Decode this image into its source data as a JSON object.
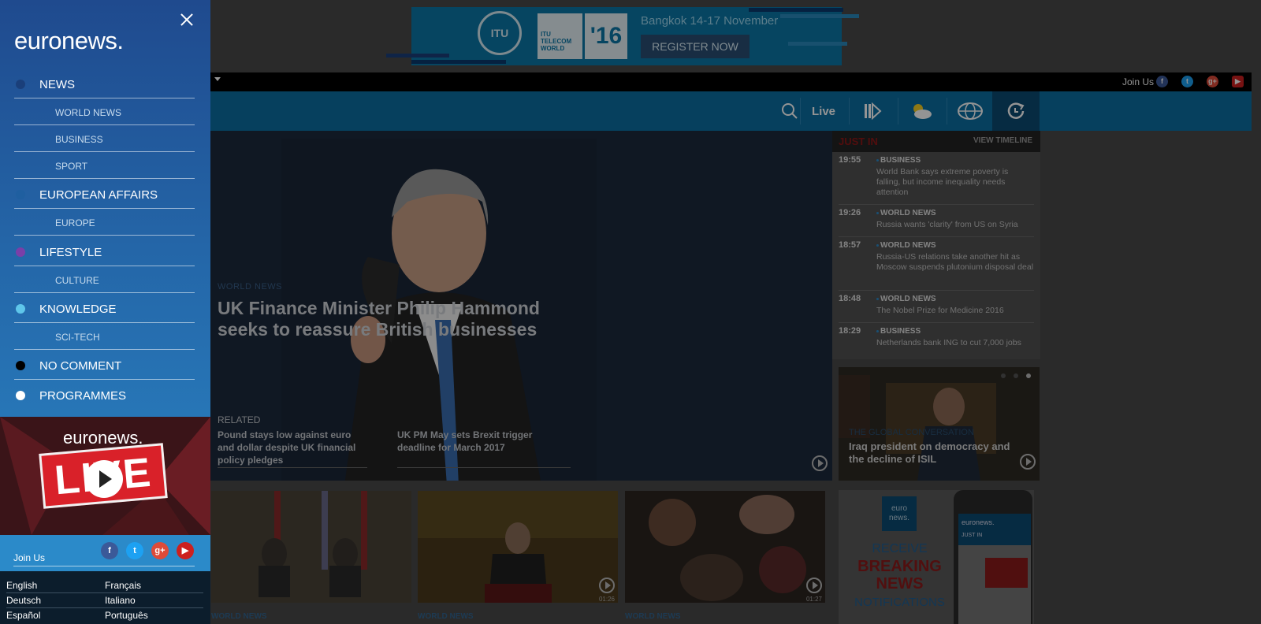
{
  "menu": {
    "brand": "euronews.",
    "items": [
      {
        "label": "NEWS",
        "dot_color": "#1a3f7a",
        "type": "main"
      },
      {
        "label": "WORLD NEWS",
        "type": "sub"
      },
      {
        "label": "BUSINESS",
        "type": "sub"
      },
      {
        "label": "SPORT",
        "type": "sub"
      },
      {
        "label": "EUROPEAN AFFAIRS",
        "dot_color": "#1f5fa0",
        "type": "main"
      },
      {
        "label": "EUROPE",
        "type": "sub"
      },
      {
        "label": "LIFESTYLE",
        "dot_color": "#7a3fa8",
        "type": "main"
      },
      {
        "label": "CULTURE",
        "type": "sub"
      },
      {
        "label": "KNOWLEDGE",
        "dot_color": "#5fc6ea",
        "type": "main"
      },
      {
        "label": "SCI-TECH",
        "type": "sub"
      },
      {
        "label": "NO COMMENT",
        "dot_color": "#000000",
        "type": "main"
      },
      {
        "label": "PROGRAMMES",
        "dot_color": "#ffffff",
        "type": "main"
      }
    ],
    "live": {
      "brand": "euronews.",
      "word": "LIVE"
    },
    "join_label": "Join Us",
    "languages": [
      "English",
      "Français",
      "Deutsch",
      "Italiano",
      "Español",
      "Português"
    ]
  },
  "ad": {
    "logo": "ITU",
    "box_text": "ITU TELECOM WORLD",
    "year": "'16",
    "date": "Bangkok 14-17 November",
    "cta": "REGISTER NOW"
  },
  "topbar": {
    "join_label": "Join Us"
  },
  "nav": {
    "live_label": "Live",
    "icons": [
      "search-icon",
      "live",
      "video-icon",
      "weather-icon",
      "globe-icon",
      "timeline-icon"
    ]
  },
  "hero": {
    "category": "WORLD NEWS",
    "title": "UK Finance Minister Philip Hammond seeks to reassure British businesses",
    "related_label": "RELATED",
    "related": [
      "Pound stays low against euro and dollar despite UK financial policy pledges",
      "UK PM May sets Brexit trigger deadline for March 2017"
    ]
  },
  "just_in": {
    "title": "JUST IN",
    "link": "VIEW TIMELINE",
    "items": [
      {
        "time": "19:55",
        "category": "BUSINESS",
        "text": "World Bank says extreme poverty is falling, but income inequality needs attention"
      },
      {
        "time": "19:26",
        "category": "WORLD NEWS",
        "text": "Russia wants 'clarity' from US on Syria"
      },
      {
        "time": "18:57",
        "category": "WORLD NEWS",
        "text": "Russia-US relations take another hit as Moscow suspends plutonium disposal deal"
      },
      {
        "time": "18:48",
        "category": "WORLD NEWS",
        "text": "The Nobel Prize for Medicine 2016"
      },
      {
        "time": "18:29",
        "category": "BUSINESS",
        "text": "Netherlands bank ING to cut 7,000 jobs"
      }
    ]
  },
  "promo": {
    "category": "THE GLOBAL CONVERSATION",
    "title": "Iraq president on democracy and the decline of ISIL"
  },
  "thumbs": [
    {
      "category": "WORLD NEWS",
      "duration": ""
    },
    {
      "category": "WORLD NEWS",
      "duration": "01:26"
    },
    {
      "category": "WORLD NEWS",
      "duration": "01:27"
    }
  ],
  "notif_ad": {
    "logo": "euro news.",
    "lines": [
      "RECEIVE",
      "BREAKING",
      "NEWS",
      "NOTIFICATIONS"
    ],
    "phone_brand": "euronews.",
    "phone_tab": "JUST IN"
  }
}
